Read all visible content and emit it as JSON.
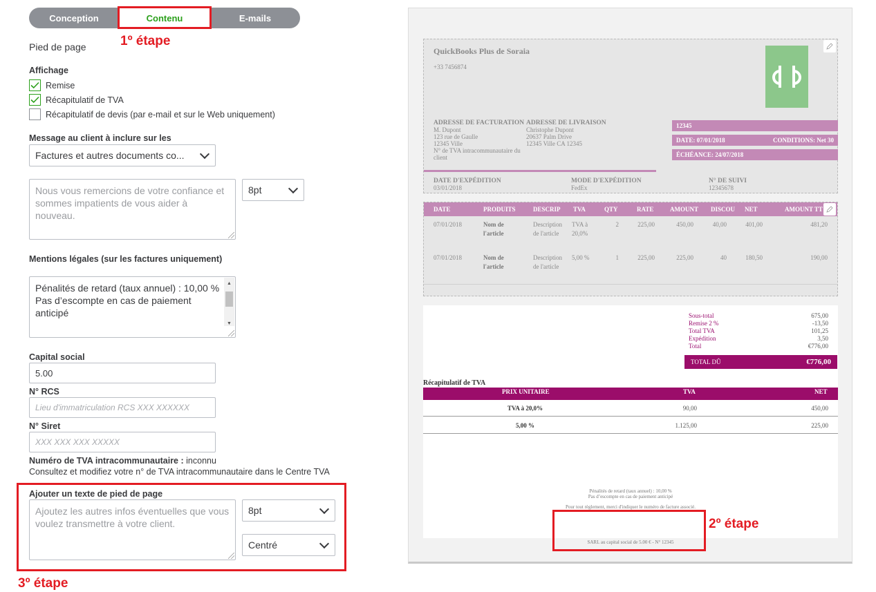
{
  "tabs": [
    {
      "label": "Conception"
    },
    {
      "label": "Contenu"
    },
    {
      "label": "E-mails"
    }
  ],
  "annotations": {
    "step1": "1º étape",
    "step2": "2º étape",
    "step3": "3º étape"
  },
  "form": {
    "section_title": "Pied de page",
    "display_label": "Affichage",
    "checkboxes": [
      {
        "label": "Remise",
        "checked": true
      },
      {
        "label": "Récapitulatif de TVA",
        "checked": true
      },
      {
        "label": "Récapitulatif de devis (par e-mail et sur le Web uniquement)",
        "checked": false
      }
    ],
    "message_label": "Message au client à inclure sur les",
    "message_select": "Factures et autres documents co...",
    "message_placeholder": "Nous vous remercions de votre confiance et sommes impatients de vous aider à nouveau.",
    "message_font_size": "8pt",
    "legal_label": "Mentions légales (sur les factures uniquement)",
    "legal_line1": "Pénalités de retard (taux annuel) : 10,00 %",
    "legal_line2": "Pas d’escompte en cas de paiement anticipé",
    "capital_label": "Capital social",
    "capital_value": "5.00",
    "rcs_label": "N° RCS",
    "rcs_placeholder": "Lieu d'immatriculation RCS XXX XXXXXX",
    "siret_label": "N° Siret",
    "siret_placeholder": "XXX XXX XXX XXXXX",
    "vat_label": "Numéro de TVA intracommunautaire :",
    "vat_value": "inconnu",
    "vat_note": "Consultez et modifiez votre n° de TVA intracommunautaire dans le Centre TVA",
    "footer_label": "Ajouter un texte de pied de page",
    "footer_placeholder": "Ajoutez les autres infos éventuelles que vous voulez transmettre à votre client.",
    "footer_font_size": "8pt",
    "footer_align": "Centré"
  },
  "invoice": {
    "company": "QuickBooks Plus de Soraia",
    "phone": "+33 7456874",
    "logo": "qb",
    "billing_title": "ADRESSE DE FACTURATION",
    "billing_lines": [
      "M. Dupont",
      "123 rue de Gaulle",
      "12345 Ville",
      "N° de TVA intracommunautaire du",
      "client"
    ],
    "shipping_title": "ADRESSE DE LIVRAISON",
    "shipping_lines": [
      "Christophe Dupont",
      "20637 Palm Drive",
      "12345 Ville CA 12345"
    ],
    "invoice_number": "12345",
    "date": "DATE:  07/01/2018",
    "terms": "CONDITIONS:  Net 30",
    "due": "ÉCHÉANCE:  24/07/2018",
    "ship_date_label": "DATE D'EXPÉDITION",
    "ship_date": "03/01/2018",
    "ship_mode_label": "MODE D'EXPÉDITION",
    "ship_mode": "FedEx",
    "tracking_label": "N° DE SUIVI",
    "tracking": "12345678",
    "columns": [
      "DATE",
      "PRODUITS",
      "DESCRIP",
      "TVA",
      "QTY",
      "RATE",
      "AMOUNT",
      "DISCOU",
      "NET",
      "AMOUNT TT"
    ],
    "rows": [
      {
        "date": "07/01/2018",
        "product": "Nom de l'article",
        "desc": "Description de l'article",
        "tva": "TVA à 20,0%",
        "qty": "2",
        "rate": "225,00",
        "amount": "450,00",
        "discount": "40,00",
        "net": "401,00",
        "total": "481,20"
      },
      {
        "date": "07/01/2018",
        "product": "Nom de l'article",
        "desc": "Description de l'article",
        "tva": "5,00 %",
        "qty": "1",
        "rate": "225,00",
        "amount": "225,00",
        "discount": "40",
        "net": "180,50",
        "total": "190,00"
      }
    ],
    "summary": [
      {
        "label": "Sous-total",
        "value": "675,00"
      },
      {
        "label": "Remise 2 %",
        "value": "-13,50"
      },
      {
        "label": "Total TVA",
        "value": "101,25"
      },
      {
        "label": "Expédition",
        "value": "3,50"
      },
      {
        "label": "Total",
        "value": "€776,00"
      }
    ],
    "total_due_label": "TOTAL DÛ",
    "total_due": "€776,00",
    "vat_summary_title": "Récapitulatif de TVA",
    "vat_columns": [
      "PRIX UNITAIRE",
      "TVA",
      "NET"
    ],
    "vat_rows": [
      {
        "rate": "TVA à 20,0%",
        "tva": "90,00",
        "net": "450,00"
      },
      {
        "rate": "5,00 %",
        "tva": "1.125,00",
        "net": "225,00"
      }
    ],
    "footer_legal1": "Pénalités de retard (taux annuel) : 10,00 %",
    "footer_legal2": "Pas d’escompte en cas de paiement anticipé",
    "footer_payment": "Pour tout règlement, merci d'indiquer le numéro de facture associé.",
    "footer_capital": "SARL au capital social de 5.00 € - N° 12345"
  },
  "colors": {
    "accent": "#2ca01c",
    "invoice_bar": "#c389b6",
    "invoice_dark": "#9b1070",
    "annotation": "#e31c23"
  }
}
